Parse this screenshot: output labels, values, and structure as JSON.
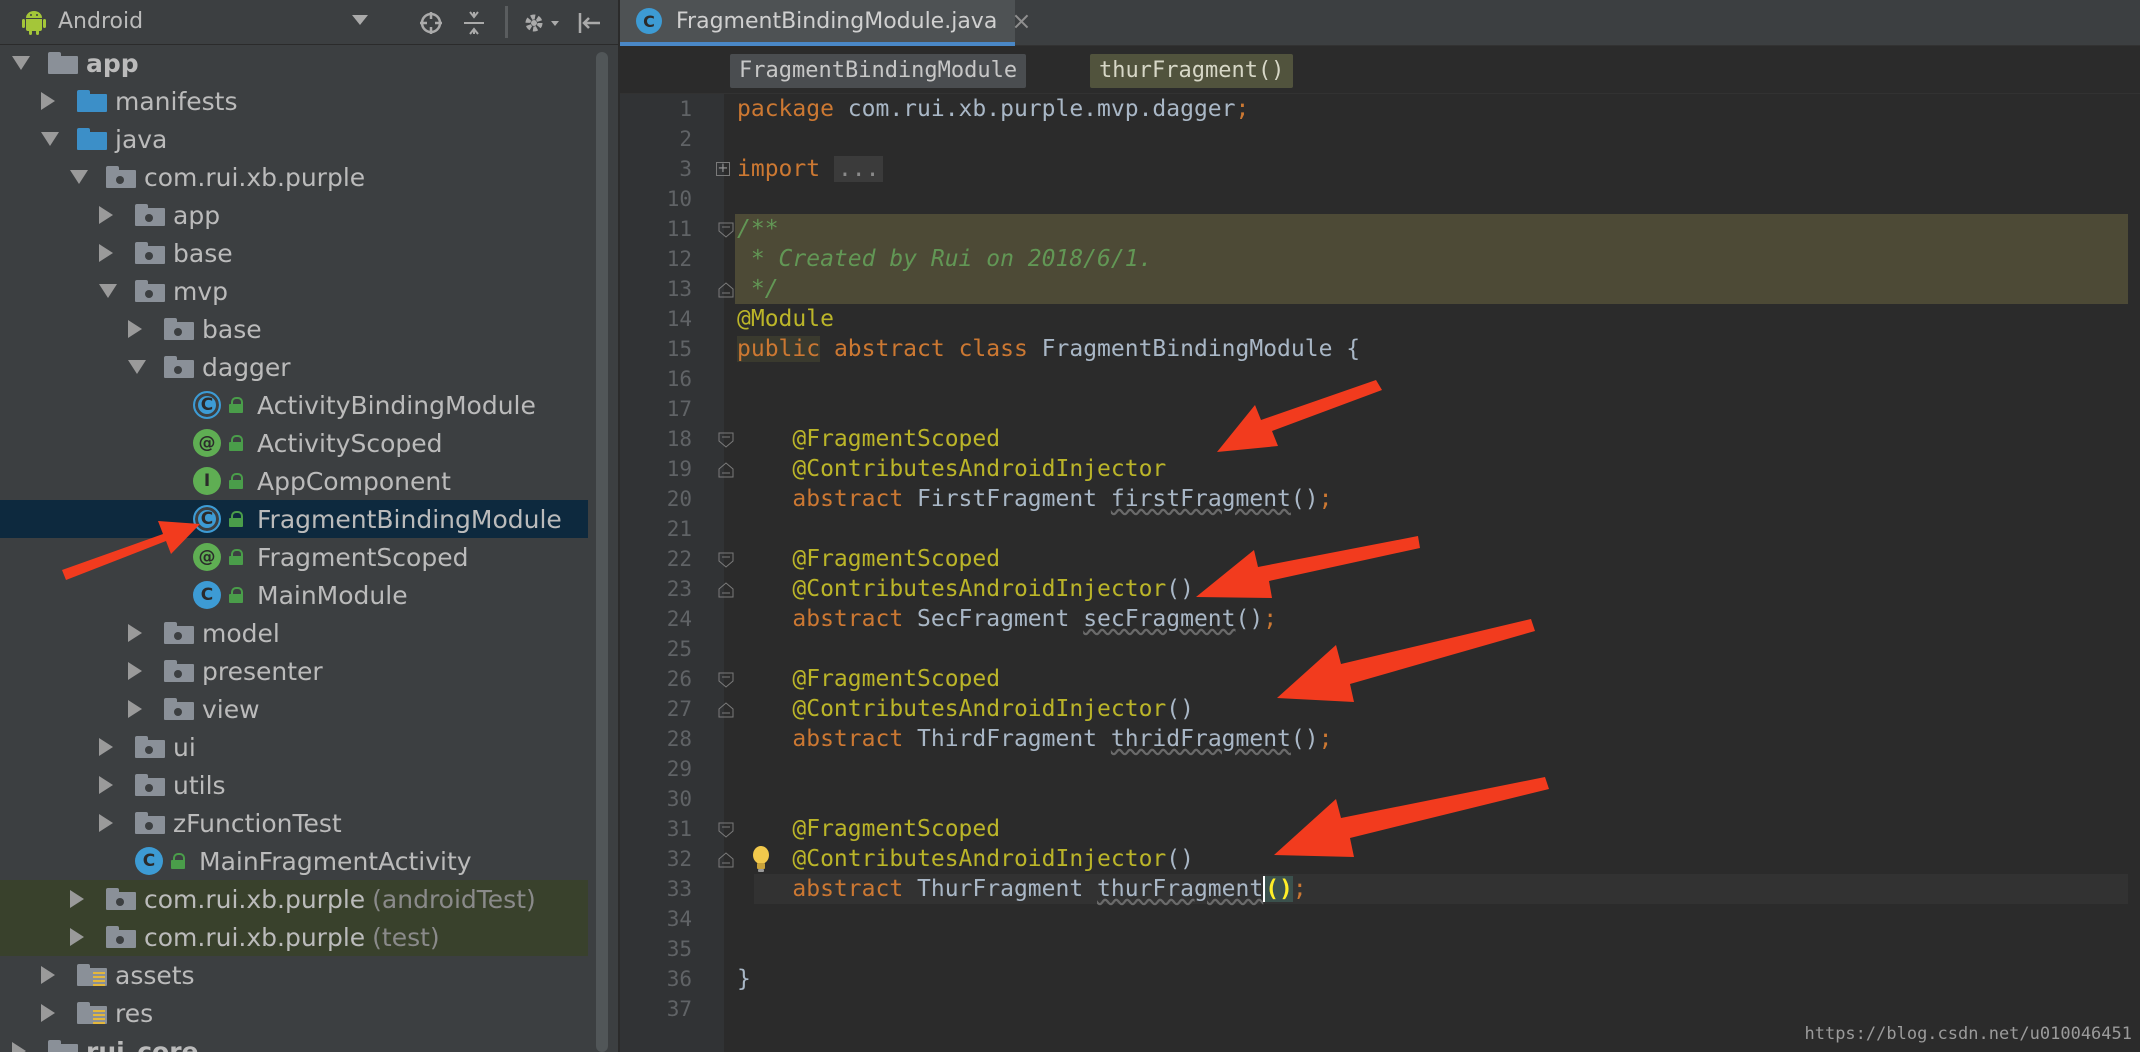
{
  "project_panel": {
    "view_selector": "Android",
    "toolbar_icons": [
      "target-icon",
      "collapse-all-icon",
      "gear-icon",
      "hide-panel-icon"
    ],
    "tree": [
      {
        "label": "app",
        "depth": 0,
        "expanded": true,
        "icon": "module-folder-icon",
        "bold": true
      },
      {
        "label": "manifests",
        "depth": 1,
        "expanded": false,
        "icon": "source-folder-icon"
      },
      {
        "label": "java",
        "depth": 1,
        "expanded": true,
        "icon": "source-folder-icon"
      },
      {
        "label": "com.rui.xb.purple",
        "depth": 2,
        "expanded": true,
        "icon": "package-icon"
      },
      {
        "label": "app",
        "depth": 3,
        "expanded": false,
        "icon": "package-icon"
      },
      {
        "label": "base",
        "depth": 3,
        "expanded": false,
        "icon": "package-icon"
      },
      {
        "label": "mvp",
        "depth": 3,
        "expanded": true,
        "icon": "package-icon"
      },
      {
        "label": "base",
        "depth": 4,
        "expanded": false,
        "icon": "package-icon"
      },
      {
        "label": "dagger",
        "depth": 4,
        "expanded": true,
        "icon": "package-icon"
      },
      {
        "label": "ActivityBindingModule",
        "depth": 5,
        "icon": "abstract-class-icon"
      },
      {
        "label": "ActivityScoped",
        "depth": 5,
        "icon": "annotation-icon"
      },
      {
        "label": "AppComponent",
        "depth": 5,
        "icon": "interface-icon"
      },
      {
        "label": "FragmentBindingModule",
        "depth": 5,
        "icon": "abstract-class-icon",
        "selected": true
      },
      {
        "label": "FragmentScoped",
        "depth": 5,
        "icon": "annotation-icon"
      },
      {
        "label": "MainModule",
        "depth": 5,
        "icon": "class-icon"
      },
      {
        "label": "model",
        "depth": 4,
        "expanded": false,
        "icon": "package-icon"
      },
      {
        "label": "presenter",
        "depth": 4,
        "expanded": false,
        "icon": "package-icon"
      },
      {
        "label": "view",
        "depth": 4,
        "expanded": false,
        "icon": "package-icon"
      },
      {
        "label": "ui",
        "depth": 3,
        "expanded": false,
        "icon": "package-icon"
      },
      {
        "label": "utils",
        "depth": 3,
        "expanded": false,
        "icon": "package-icon"
      },
      {
        "label": "zFunctionTest",
        "depth": 3,
        "expanded": false,
        "icon": "package-icon"
      },
      {
        "label": "MainFragmentActivity",
        "depth": 3,
        "icon": "class-icon"
      },
      {
        "label": "com.rui.xb.purple",
        "suffix": "(androidTest)",
        "depth": 2,
        "expanded": false,
        "icon": "package-icon",
        "test": true
      },
      {
        "label": "com.rui.xb.purple",
        "suffix": "(test)",
        "depth": 2,
        "expanded": false,
        "icon": "package-icon",
        "test": true
      },
      {
        "label": "assets",
        "depth": 1,
        "expanded": false,
        "icon": "resource-folder-icon"
      },
      {
        "label": "res",
        "depth": 1,
        "expanded": false,
        "icon": "resource-folder-icon"
      },
      {
        "label": "rui_core",
        "depth": 0,
        "expanded": false,
        "icon": "module-folder-icon",
        "bold": true
      }
    ]
  },
  "editor": {
    "tab_title": "FragmentBindingModule.java",
    "breadcrumbs": [
      "FragmentBindingModule",
      "thurFragment()"
    ],
    "lines": [
      {
        "n": "1",
        "tokens": [
          [
            "kw",
            "package "
          ],
          [
            "ident",
            "com.rui.xb.purple.mvp.dagger"
          ],
          [
            "kw",
            ";"
          ]
        ]
      },
      {
        "n": "2",
        "tokens": []
      },
      {
        "n": "3",
        "tokens": [
          [
            "kw",
            "import "
          ],
          [
            "folded",
            "..."
          ]
        ],
        "fold": "plus"
      },
      {
        "n": "10",
        "tokens": []
      },
      {
        "n": "11",
        "tokens": [
          [
            "doc",
            "/**"
          ]
        ],
        "doc": true,
        "fold": "open"
      },
      {
        "n": "12",
        "tokens": [
          [
            "doc",
            " * Created by Rui on 2018/6/1."
          ]
        ],
        "doc": true
      },
      {
        "n": "13",
        "tokens": [
          [
            "doc",
            " */"
          ]
        ],
        "doc": true,
        "fold": "close"
      },
      {
        "n": "14",
        "tokens": [
          [
            "ann",
            "@Module"
          ]
        ]
      },
      {
        "n": "15",
        "tokens": [
          [
            "kwhl",
            "public"
          ],
          [
            "kw",
            " abstract class "
          ],
          [
            "ident",
            "FragmentBindingModule {"
          ]
        ]
      },
      {
        "n": "16",
        "tokens": []
      },
      {
        "n": "17",
        "tokens": []
      },
      {
        "n": "18",
        "tokens": [
          [
            "ident",
            "    "
          ],
          [
            "ann",
            "@FragmentScoped"
          ]
        ],
        "fold": "open"
      },
      {
        "n": "19",
        "tokens": [
          [
            "ident",
            "    "
          ],
          [
            "ann",
            "@ContributesAndroidInjector"
          ]
        ],
        "fold": "close"
      },
      {
        "n": "20",
        "tokens": [
          [
            "kw",
            "    abstract "
          ],
          [
            "ident",
            "FirstFragment "
          ],
          [
            "unused",
            "firstFragment"
          ],
          [
            "ident",
            "()"
          ],
          [
            "kw",
            ";"
          ]
        ]
      },
      {
        "n": "21",
        "tokens": []
      },
      {
        "n": "22",
        "tokens": [
          [
            "ident",
            "    "
          ],
          [
            "ann",
            "@FragmentScoped"
          ]
        ],
        "fold": "open"
      },
      {
        "n": "23",
        "tokens": [
          [
            "ident",
            "    "
          ],
          [
            "ann",
            "@ContributesAndroidInjector"
          ],
          [
            "ident",
            "()"
          ]
        ],
        "fold": "close"
      },
      {
        "n": "24",
        "tokens": [
          [
            "kw",
            "    abstract "
          ],
          [
            "ident",
            "SecFragment "
          ],
          [
            "unused",
            "secFragment"
          ],
          [
            "ident",
            "()"
          ],
          [
            "kw",
            ";"
          ]
        ]
      },
      {
        "n": "25",
        "tokens": []
      },
      {
        "n": "26",
        "tokens": [
          [
            "ident",
            "    "
          ],
          [
            "ann",
            "@FragmentScoped"
          ]
        ],
        "fold": "open"
      },
      {
        "n": "27",
        "tokens": [
          [
            "ident",
            "    "
          ],
          [
            "ann",
            "@ContributesAndroidInjector"
          ],
          [
            "ident",
            "()"
          ]
        ],
        "fold": "close"
      },
      {
        "n": "28",
        "tokens": [
          [
            "kw",
            "    abstract "
          ],
          [
            "ident",
            "ThirdFragment "
          ],
          [
            "unused",
            "thridFragment"
          ],
          [
            "ident",
            "()"
          ],
          [
            "kw",
            ";"
          ]
        ]
      },
      {
        "n": "29",
        "tokens": []
      },
      {
        "n": "30",
        "tokens": []
      },
      {
        "n": "31",
        "tokens": [
          [
            "ident",
            "    "
          ],
          [
            "ann",
            "@FragmentScoped"
          ]
        ],
        "fold": "open"
      },
      {
        "n": "32",
        "tokens": [
          [
            "ident",
            "    "
          ],
          [
            "ann",
            "@ContributesAndroidInjector"
          ],
          [
            "ident",
            "()"
          ]
        ],
        "fold": "close",
        "bulb": true
      },
      {
        "n": "33",
        "tokens": [
          [
            "kw",
            "    abstract "
          ],
          [
            "ident",
            "ThurFragment "
          ],
          [
            "unused",
            "thurFragment"
          ],
          [
            "caret",
            ""
          ],
          [
            "parenhl",
            "()"
          ],
          [
            "kw",
            ";"
          ]
        ],
        "caret_line": true
      },
      {
        "n": "34",
        "tokens": []
      },
      {
        "n": "35",
        "tokens": []
      },
      {
        "n": "36",
        "tokens": [
          [
            "ident",
            "}"
          ]
        ]
      },
      {
        "n": "37",
        "tokens": []
      }
    ]
  },
  "colors": {
    "keyword": "#cc7832",
    "annotation": "#bbb529",
    "doc_comment": "#629755",
    "identifier": "#a9b7c6",
    "selection": "#0d293e",
    "arrow_annotation": "#f23b1e"
  },
  "watermark": "https://blog.csdn.net/u010046451"
}
